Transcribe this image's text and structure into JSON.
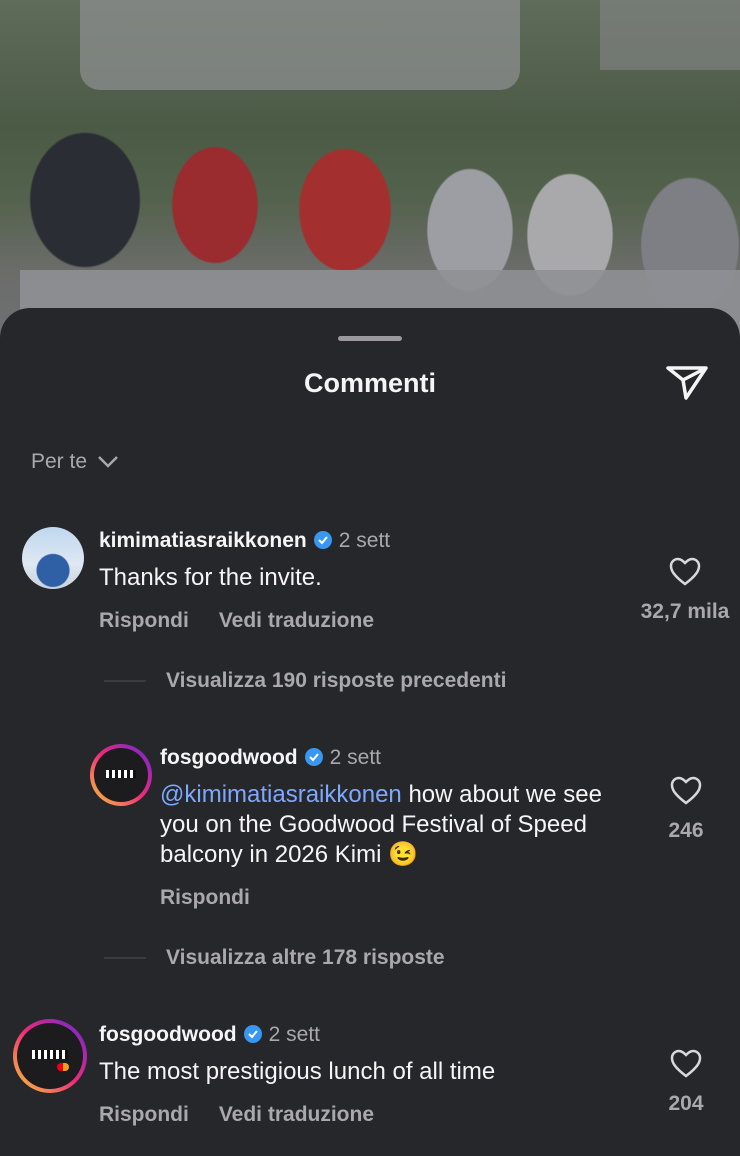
{
  "sheet": {
    "title": "Commenti"
  },
  "sort": {
    "label": "Per te"
  },
  "comments": [
    {
      "username": "kimimatiasraikkonen",
      "time": "2 sett",
      "text": "Thanks for the invite.",
      "reply_label": "Rispondi",
      "translate_label": "Vedi traduzione",
      "likes": "32,7 mila"
    },
    {
      "username": "fosgoodwood",
      "time": "2 sett",
      "mention": "@kimimatiasraikkonen",
      "text": " how about we see you on the Goodwood Festival of Speed balcony in 2026 Kimi 😉",
      "reply_label": "Rispondi",
      "likes": "246"
    },
    {
      "username": "fosgoodwood",
      "time": "2 sett",
      "text": "The most prestigious lunch of all time",
      "reply_label": "Rispondi",
      "translate_label": "Vedi traduzione",
      "likes": "204"
    }
  ],
  "view_previous": "Visualizza 190 risposte precedenti",
  "view_more": "Visualizza altre 178 risposte",
  "colors": {
    "background": "#26272b",
    "mention": "#7ea8ff",
    "verified": "#3897f0",
    "story_ring_start": "#f9ce34",
    "story_ring_end": "#c13584"
  }
}
